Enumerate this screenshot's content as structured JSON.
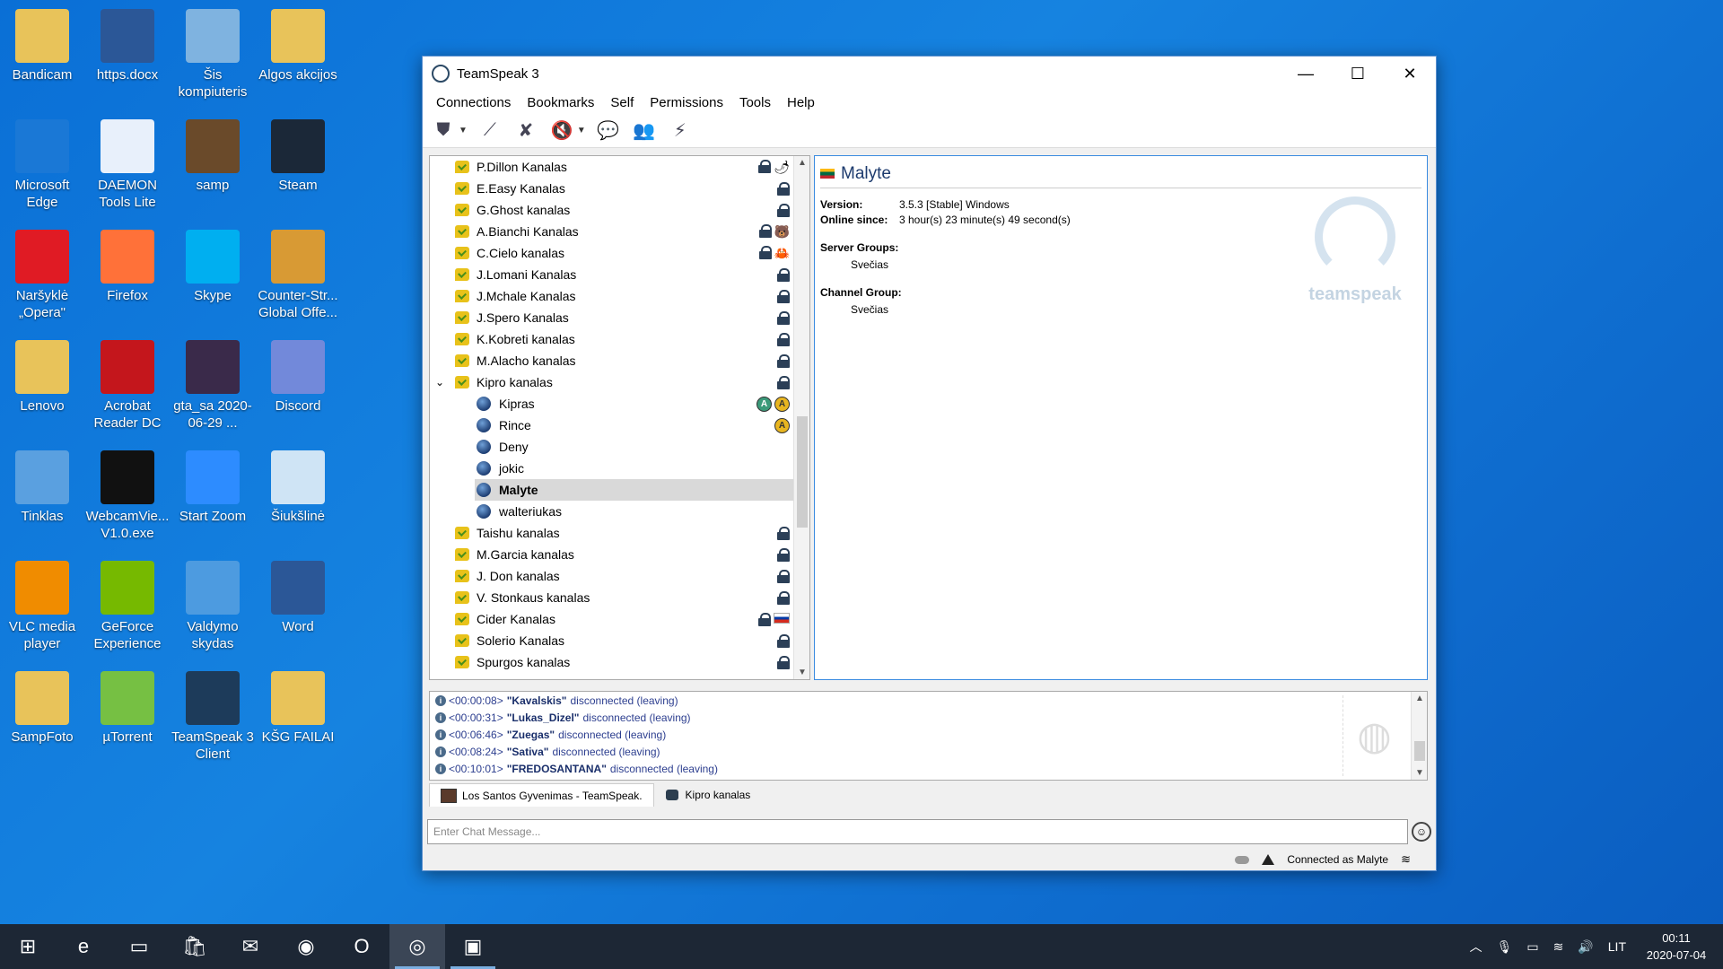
{
  "desktop": {
    "icons": [
      {
        "label": "Bandicam",
        "icon": "folder-icon",
        "color": "#e8c35a"
      },
      {
        "label": "https.docx",
        "icon": "word-doc-icon",
        "color": "#2b5797"
      },
      {
        "label": "Šis kompiuteris",
        "icon": "computer-icon",
        "color": "#7fb3e0"
      },
      {
        "label": "Algos akcijos",
        "icon": "folder-icon",
        "color": "#e8c35a"
      },
      {
        "label": "Microsoft Edge",
        "icon": "edge-icon",
        "color": "#1a78d6"
      },
      {
        "label": "DAEMON Tools Lite",
        "icon": "daemon-tools-icon",
        "color": "#e8f0fb"
      },
      {
        "label": "samp",
        "icon": "samp-icon",
        "color": "#6a4a2a"
      },
      {
        "label": "Steam",
        "icon": "steam-icon",
        "color": "#1b2838"
      },
      {
        "label": "Naršyklė „Opera\"",
        "icon": "opera-icon",
        "color": "#e01b24"
      },
      {
        "label": "Firefox",
        "icon": "firefox-icon",
        "color": "#ff7139"
      },
      {
        "label": "Skype",
        "icon": "skype-icon",
        "color": "#00aff0"
      },
      {
        "label": "Counter-Str... Global Offe...",
        "icon": "csgo-icon",
        "color": "#d89a34"
      },
      {
        "label": "Lenovo",
        "icon": "user-folder-icon",
        "color": "#e8c35a"
      },
      {
        "label": "Acrobat Reader DC",
        "icon": "acrobat-icon",
        "color": "#c4161c"
      },
      {
        "label": "gta_sa 2020-06-29 ...",
        "icon": "video-thumb-icon",
        "color": "#3a2a4a"
      },
      {
        "label": "Discord",
        "icon": "discord-icon",
        "color": "#7289da"
      },
      {
        "label": "Tinklas",
        "icon": "network-icon",
        "color": "#5aa0e0"
      },
      {
        "label": "WebcamVie... V1.0.exe",
        "icon": "webcam-icon",
        "color": "#111111"
      },
      {
        "label": "Start Zoom",
        "icon": "zoom-icon",
        "color": "#2d8cff"
      },
      {
        "label": "Šiukšlinė",
        "icon": "recycle-bin-icon",
        "color": "#cfe4f5"
      },
      {
        "label": "VLC media player",
        "icon": "vlc-icon",
        "color": "#f08c00"
      },
      {
        "label": "GeForce Experience",
        "icon": "nvidia-icon",
        "color": "#76b900"
      },
      {
        "label": "Valdymo skydas",
        "icon": "control-panel-icon",
        "color": "#4d9be0"
      },
      {
        "label": "Word",
        "icon": "word-icon",
        "color": "#2b5797"
      },
      {
        "label": "SampFoto",
        "icon": "folder-icon",
        "color": "#e8c35a"
      },
      {
        "label": "µTorrent",
        "icon": "utorrent-icon",
        "color": "#76c043"
      },
      {
        "label": "TeamSpeak 3 Client",
        "icon": "teamspeak-icon",
        "color": "#1d3b5a"
      },
      {
        "label": "KŠG FAILAI",
        "icon": "folder-icon",
        "color": "#e8c35a"
      }
    ]
  },
  "window": {
    "title": "TeamSpeak 3",
    "minimize": "—",
    "maximize": "☐",
    "close": "✕"
  },
  "menu": [
    "Connections",
    "Bookmarks",
    "Self",
    "Permissions",
    "Tools",
    "Help"
  ],
  "toolbar": [
    {
      "name": "connect-icon",
      "glyph": "⛊",
      "dropdown": true
    },
    {
      "name": "disconnect-icon",
      "glyph": "⟋"
    },
    {
      "name": "mute-microphone-icon",
      "glyph": "✘"
    },
    {
      "name": "mute-speakers-icon",
      "glyph": "🔇",
      "dropdown": true
    },
    {
      "name": "away-icon",
      "glyph": "💬"
    },
    {
      "name": "contacts-icon",
      "glyph": "👥"
    },
    {
      "name": "hotkeys-icon",
      "glyph": "⚡"
    }
  ],
  "tree": {
    "rows": [
      {
        "type": "channel",
        "label": "P.Dillon Kanalas",
        "lock": true,
        "extra": "🌶"
      },
      {
        "type": "channel",
        "label": "E.Easy Kanalas",
        "lock": true
      },
      {
        "type": "channel",
        "label": "G.Ghost kanalas",
        "lock": true
      },
      {
        "type": "channel",
        "label": "A.Bianchi Kanalas",
        "lock": true,
        "extra": "🐻"
      },
      {
        "type": "channel",
        "label": "C.Cielo kanalas",
        "lock": true,
        "extra": "🦀"
      },
      {
        "type": "channel",
        "label": "J.Lomani Kanalas",
        "lock": true
      },
      {
        "type": "channel",
        "label": "J.Mchale Kanalas",
        "lock": true
      },
      {
        "type": "channel",
        "label": "J.Spero Kanalas",
        "lock": true
      },
      {
        "type": "channel",
        "label": "K.Kobreti kanalas",
        "lock": true
      },
      {
        "type": "channel",
        "label": "M.Alacho kanalas",
        "lock": true
      },
      {
        "type": "channel",
        "label": "Kipro kanalas",
        "lock": true,
        "expanded": true
      },
      {
        "type": "client",
        "label": "Kipras",
        "badges": [
          "A",
          "A"
        ]
      },
      {
        "type": "client",
        "label": "Rince",
        "badges": [
          "A"
        ]
      },
      {
        "type": "client",
        "label": "Deny"
      },
      {
        "type": "client",
        "label": "jokic"
      },
      {
        "type": "client",
        "label": "Malyte",
        "selected": true
      },
      {
        "type": "client",
        "label": "walteriukas"
      },
      {
        "type": "channel",
        "label": "Taishu kanalas",
        "lock": true
      },
      {
        "type": "channel",
        "label": "M.Garcia kanalas",
        "lock": true
      },
      {
        "type": "channel",
        "label": "J. Don kanalas",
        "lock": true
      },
      {
        "type": "channel",
        "label": "V. Stonkaus kanalas",
        "lock": true
      },
      {
        "type": "channel",
        "label": "Cider Kanalas",
        "lock": true,
        "extra": "flag-ru"
      },
      {
        "type": "channel",
        "label": "Solerio Kanalas",
        "lock": true
      },
      {
        "type": "channel",
        "label": "Spurgos kanalas",
        "lock": true
      }
    ]
  },
  "info": {
    "name": "Malyte",
    "version_label": "Version:",
    "version": "3.5.3 [Stable] Windows",
    "online_label": "Online since:",
    "online": "3 hour(s) 23 minute(s) 49 second(s)",
    "server_groups_label": "Server Groups:",
    "server_group": "Svečias",
    "channel_group_label": "Channel Group:",
    "channel_group": "Svečias",
    "watermark": "teamspeak"
  },
  "log": [
    {
      "time": "<00:00:08>",
      "name": "\"Kavalskis\"",
      "msg": "disconnected (leaving)"
    },
    {
      "time": "<00:00:31>",
      "name": "\"Lukas_Dizel\"",
      "msg": "disconnected (leaving)"
    },
    {
      "time": "<00:06:46>",
      "name": "\"Zuegas\"",
      "msg": "disconnected (leaving)"
    },
    {
      "time": "<00:08:24>",
      "name": "\"Sativa\"",
      "msg": "disconnected (leaving)"
    },
    {
      "time": "<00:10:01>",
      "name": "\"FREDOSANTANA\"",
      "msg": "disconnected (leaving)"
    }
  ],
  "tabs": [
    "Los Santos Gyvenimas - TeamSpeak.",
    "Kipro kanalas"
  ],
  "chat": {
    "placeholder": "Enter Chat Message..."
  },
  "status": {
    "connected": "Connected as Malyte"
  },
  "taskbar": {
    "items": [
      {
        "name": "start-button",
        "glyph": "⊞"
      },
      {
        "name": "edge-taskbar-icon",
        "glyph": "e"
      },
      {
        "name": "file-explorer-icon",
        "glyph": "▭"
      },
      {
        "name": "store-icon",
        "glyph": "🛍"
      },
      {
        "name": "mail-icon",
        "glyph": "✉"
      },
      {
        "name": "firefox-taskbar-icon",
        "glyph": "◉"
      },
      {
        "name": "opera-taskbar-icon",
        "glyph": "O"
      },
      {
        "name": "teamspeak-taskbar-icon",
        "glyph": "◎",
        "active": true
      },
      {
        "name": "samp-taskbar-icon",
        "glyph": "▣",
        "open": true
      }
    ],
    "lang": "LIT",
    "time": "00:11",
    "date": "2020-07-04"
  }
}
